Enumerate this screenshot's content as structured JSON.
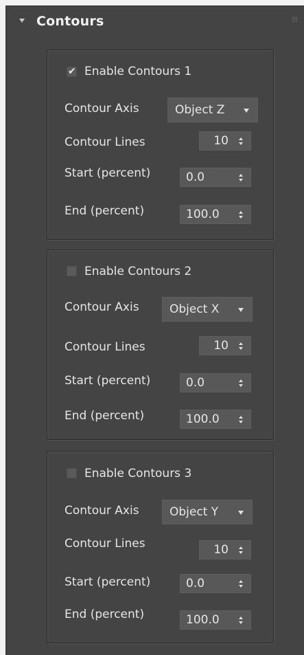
{
  "rollout": {
    "title": "Contours",
    "expanded": true,
    "icons": {
      "collapse": "triangle-down-icon",
      "grip": "grip-dots-icon"
    }
  },
  "labels": {
    "contour_axis": "Contour Axis",
    "contour_lines": "Contour Lines",
    "start": "Start (percent)",
    "end": "End (percent)"
  },
  "groups": [
    {
      "enable_label": "Enable Contours 1",
      "enabled": true,
      "axis": "Object Z",
      "lines": "10",
      "start": "0.0",
      "end": "100.0"
    },
    {
      "enable_label": "Enable Contours 2",
      "enabled": false,
      "axis": "Object X",
      "lines": "10",
      "start": "0.0",
      "end": "100.0"
    },
    {
      "enable_label": "Enable Contours 3",
      "enabled": false,
      "axis": "Object Y",
      "lines": "10",
      "start": "0.0",
      "end": "100.0"
    }
  ],
  "colors": {
    "panel_bg": "#444444",
    "control_bg": "#585858",
    "text": "#e6e6e6",
    "page_bg": "#f2f2f2"
  }
}
